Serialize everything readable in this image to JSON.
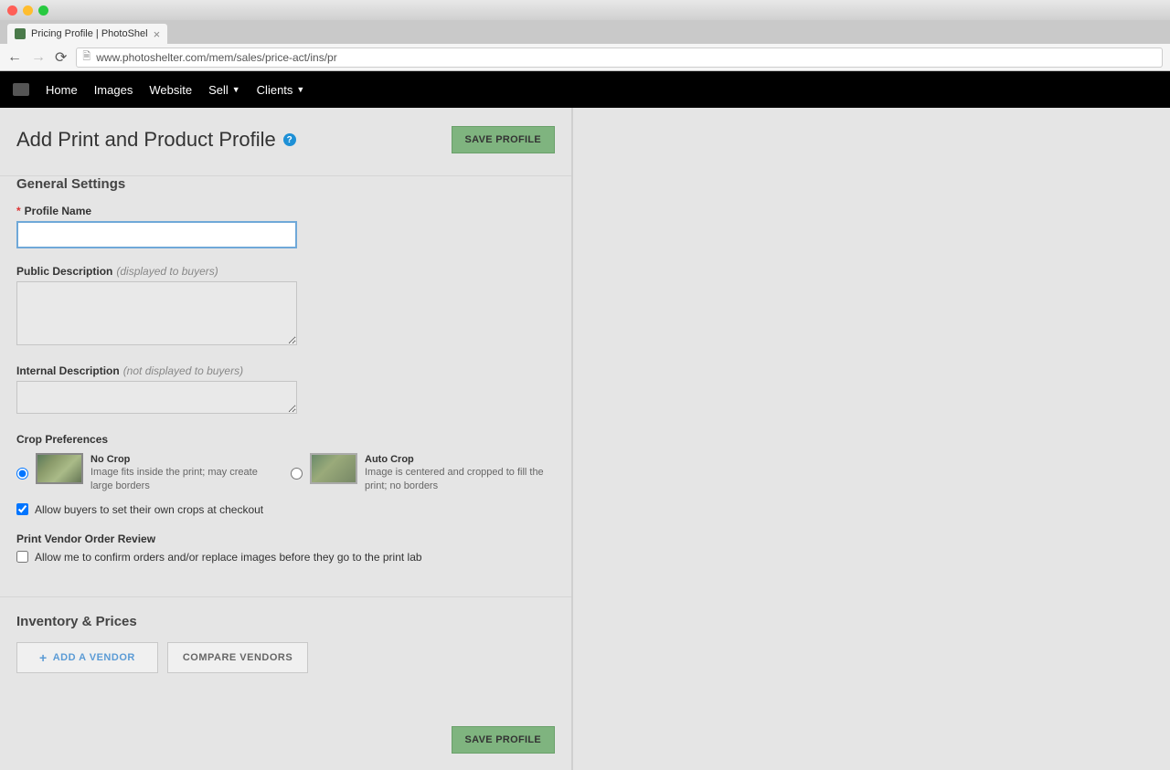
{
  "browser": {
    "tab_title": "Pricing Profile | PhotoShel",
    "url": "www.photoshelter.com/mem/sales/price-act/ins/pr"
  },
  "nav": {
    "items": [
      "Home",
      "Images",
      "Website",
      "Sell",
      "Clients"
    ]
  },
  "page": {
    "title": "Add Print and Product Profile",
    "save_button": "SAVE PROFILE"
  },
  "general": {
    "section_title": "General Settings",
    "profile_name_label": "Profile Name",
    "profile_name_value": "",
    "public_desc_label": "Public Description",
    "public_desc_hint": "(displayed to buyers)",
    "public_desc_value": "",
    "internal_desc_label": "Internal Description",
    "internal_desc_hint": "(not displayed to buyers)",
    "internal_desc_value": "",
    "crop_prefs_label": "Crop Preferences",
    "crop_options": [
      {
        "name": "No Crop",
        "desc": "Image fits inside the print; may create large borders",
        "checked": true
      },
      {
        "name": "Auto Crop",
        "desc": "Image is centered and cropped to fill the print; no borders",
        "checked": false
      }
    ],
    "allow_buyer_crop_label": "Allow buyers to set their own crops at checkout",
    "allow_buyer_crop_checked": true,
    "vendor_review_label": "Print Vendor Order Review",
    "vendor_review_checkbox": "Allow me to confirm orders and/or replace images before they go to the print lab",
    "vendor_review_checked": false
  },
  "inventory": {
    "section_title": "Inventory & Prices",
    "add_vendor": "ADD A VENDOR",
    "compare_vendors": "COMPARE VENDORS"
  }
}
